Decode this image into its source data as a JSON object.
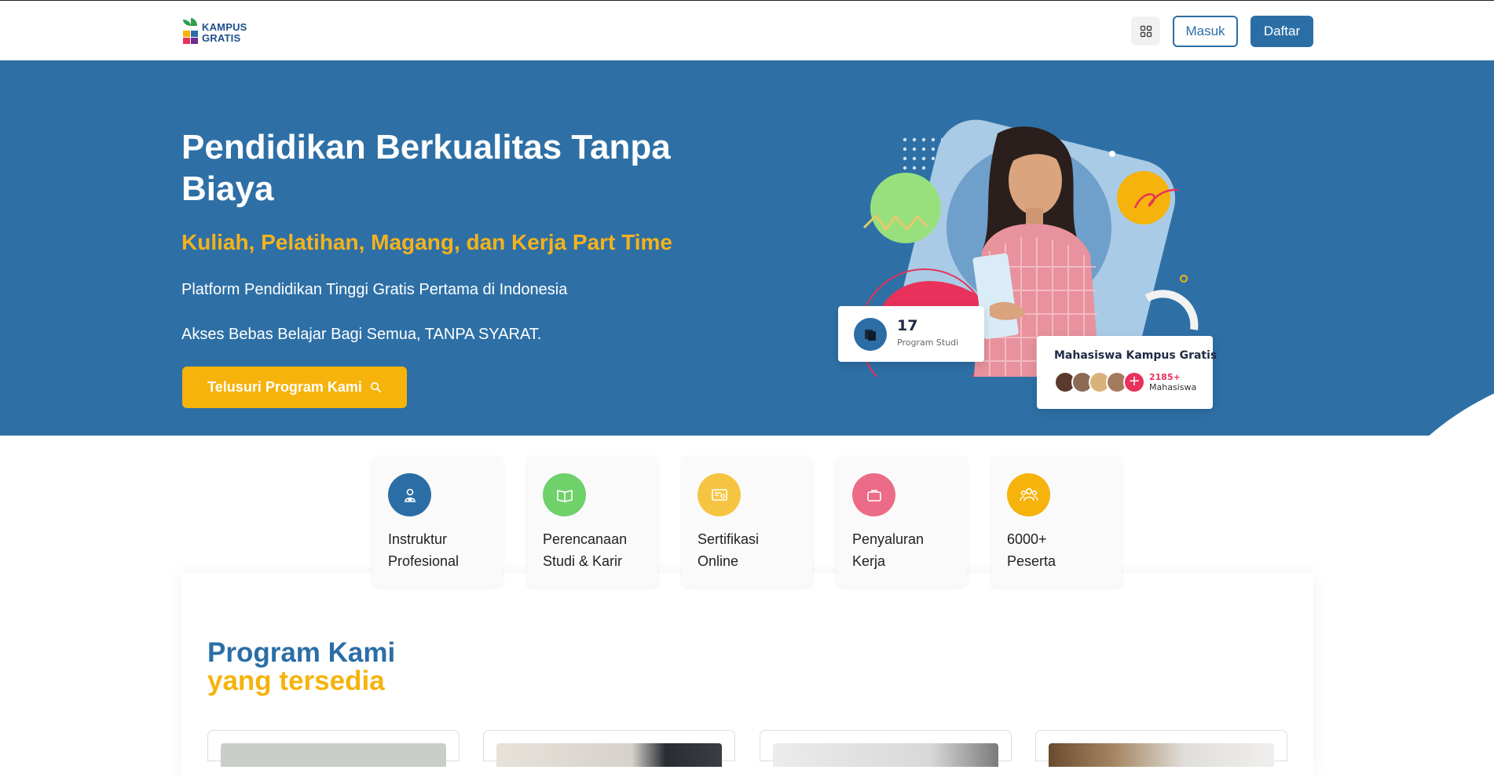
{
  "nav": {
    "logo_line1": "KAMPUS",
    "logo_line2": "GRATIS",
    "menu_icon": "grid-icon",
    "login_label": "Masuk",
    "register_label": "Daftar"
  },
  "hero": {
    "title": "Pendidikan Berkualitas Tanpa Biaya",
    "subtitle": "Kuliah, Pelatihan, Magang, dan Kerja Part Time",
    "paragraph1": "Platform Pendidikan Tinggi Gratis Pertama di Indonesia",
    "paragraph2": "Akses Bebas Belajar Bagi Semua, TANPA SYARAT.",
    "cta_label": "Telusuri Program Kami",
    "cta_icon": "search-icon",
    "stat_card": {
      "value": "17",
      "label": "Program Studi",
      "icon": "book-icon"
    },
    "students_card": {
      "title": "Mahasiswa Kampus Gratis",
      "count": "2185+",
      "label": "Mahasiswa"
    }
  },
  "features": [
    {
      "line1": "Instruktur",
      "line2": "Profesional",
      "icon": "instructor-icon",
      "color": "#2b6ea6"
    },
    {
      "line1": "Perencanaan",
      "line2": "Studi & Karir",
      "icon": "open-book-icon",
      "color": "#6fd16a"
    },
    {
      "line1": "Sertifikasi",
      "line2": "Online",
      "icon": "certificate-icon",
      "color": "#f5c542"
    },
    {
      "line1": "Penyaluran",
      "line2": "Kerja",
      "icon": "briefcase-icon",
      "color": "#ec6b86"
    },
    {
      "line1": "6000+",
      "line2": "Peserta",
      "icon": "users-icon",
      "color": "#f5b30b"
    }
  ],
  "programs": {
    "title": "Program Kami",
    "subtitle": "yang tersedia"
  },
  "colors": {
    "primary": "#2e70a6",
    "accent": "#f5b30b",
    "pink": "#e8315b"
  }
}
